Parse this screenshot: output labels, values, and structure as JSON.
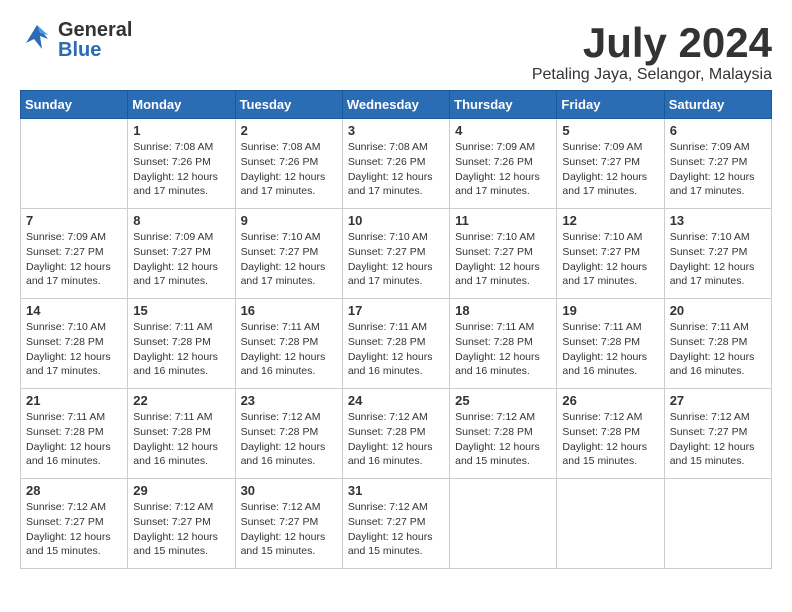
{
  "header": {
    "logo_general": "General",
    "logo_blue": "Blue",
    "month_title": "July 2024",
    "location": "Petaling Jaya, Selangor, Malaysia"
  },
  "days_of_week": [
    "Sunday",
    "Monday",
    "Tuesday",
    "Wednesday",
    "Thursday",
    "Friday",
    "Saturday"
  ],
  "weeks": [
    [
      {
        "num": "",
        "info": ""
      },
      {
        "num": "1",
        "info": "Sunrise: 7:08 AM\nSunset: 7:26 PM\nDaylight: 12 hours\nand 17 minutes."
      },
      {
        "num": "2",
        "info": "Sunrise: 7:08 AM\nSunset: 7:26 PM\nDaylight: 12 hours\nand 17 minutes."
      },
      {
        "num": "3",
        "info": "Sunrise: 7:08 AM\nSunset: 7:26 PM\nDaylight: 12 hours\nand 17 minutes."
      },
      {
        "num": "4",
        "info": "Sunrise: 7:09 AM\nSunset: 7:26 PM\nDaylight: 12 hours\nand 17 minutes."
      },
      {
        "num": "5",
        "info": "Sunrise: 7:09 AM\nSunset: 7:27 PM\nDaylight: 12 hours\nand 17 minutes."
      },
      {
        "num": "6",
        "info": "Sunrise: 7:09 AM\nSunset: 7:27 PM\nDaylight: 12 hours\nand 17 minutes."
      }
    ],
    [
      {
        "num": "7",
        "info": "Sunrise: 7:09 AM\nSunset: 7:27 PM\nDaylight: 12 hours\nand 17 minutes."
      },
      {
        "num": "8",
        "info": "Sunrise: 7:09 AM\nSunset: 7:27 PM\nDaylight: 12 hours\nand 17 minutes."
      },
      {
        "num": "9",
        "info": "Sunrise: 7:10 AM\nSunset: 7:27 PM\nDaylight: 12 hours\nand 17 minutes."
      },
      {
        "num": "10",
        "info": "Sunrise: 7:10 AM\nSunset: 7:27 PM\nDaylight: 12 hours\nand 17 minutes."
      },
      {
        "num": "11",
        "info": "Sunrise: 7:10 AM\nSunset: 7:27 PM\nDaylight: 12 hours\nand 17 minutes."
      },
      {
        "num": "12",
        "info": "Sunrise: 7:10 AM\nSunset: 7:27 PM\nDaylight: 12 hours\nand 17 minutes."
      },
      {
        "num": "13",
        "info": "Sunrise: 7:10 AM\nSunset: 7:27 PM\nDaylight: 12 hours\nand 17 minutes."
      }
    ],
    [
      {
        "num": "14",
        "info": "Sunrise: 7:10 AM\nSunset: 7:28 PM\nDaylight: 12 hours\nand 17 minutes."
      },
      {
        "num": "15",
        "info": "Sunrise: 7:11 AM\nSunset: 7:28 PM\nDaylight: 12 hours\nand 16 minutes."
      },
      {
        "num": "16",
        "info": "Sunrise: 7:11 AM\nSunset: 7:28 PM\nDaylight: 12 hours\nand 16 minutes."
      },
      {
        "num": "17",
        "info": "Sunrise: 7:11 AM\nSunset: 7:28 PM\nDaylight: 12 hours\nand 16 minutes."
      },
      {
        "num": "18",
        "info": "Sunrise: 7:11 AM\nSunset: 7:28 PM\nDaylight: 12 hours\nand 16 minutes."
      },
      {
        "num": "19",
        "info": "Sunrise: 7:11 AM\nSunset: 7:28 PM\nDaylight: 12 hours\nand 16 minutes."
      },
      {
        "num": "20",
        "info": "Sunrise: 7:11 AM\nSunset: 7:28 PM\nDaylight: 12 hours\nand 16 minutes."
      }
    ],
    [
      {
        "num": "21",
        "info": "Sunrise: 7:11 AM\nSunset: 7:28 PM\nDaylight: 12 hours\nand 16 minutes."
      },
      {
        "num": "22",
        "info": "Sunrise: 7:11 AM\nSunset: 7:28 PM\nDaylight: 12 hours\nand 16 minutes."
      },
      {
        "num": "23",
        "info": "Sunrise: 7:12 AM\nSunset: 7:28 PM\nDaylight: 12 hours\nand 16 minutes."
      },
      {
        "num": "24",
        "info": "Sunrise: 7:12 AM\nSunset: 7:28 PM\nDaylight: 12 hours\nand 16 minutes."
      },
      {
        "num": "25",
        "info": "Sunrise: 7:12 AM\nSunset: 7:28 PM\nDaylight: 12 hours\nand 15 minutes."
      },
      {
        "num": "26",
        "info": "Sunrise: 7:12 AM\nSunset: 7:28 PM\nDaylight: 12 hours\nand 15 minutes."
      },
      {
        "num": "27",
        "info": "Sunrise: 7:12 AM\nSunset: 7:27 PM\nDaylight: 12 hours\nand 15 minutes."
      }
    ],
    [
      {
        "num": "28",
        "info": "Sunrise: 7:12 AM\nSunset: 7:27 PM\nDaylight: 12 hours\nand 15 minutes."
      },
      {
        "num": "29",
        "info": "Sunrise: 7:12 AM\nSunset: 7:27 PM\nDaylight: 12 hours\nand 15 minutes."
      },
      {
        "num": "30",
        "info": "Sunrise: 7:12 AM\nSunset: 7:27 PM\nDaylight: 12 hours\nand 15 minutes."
      },
      {
        "num": "31",
        "info": "Sunrise: 7:12 AM\nSunset: 7:27 PM\nDaylight: 12 hours\nand 15 minutes."
      },
      {
        "num": "",
        "info": ""
      },
      {
        "num": "",
        "info": ""
      },
      {
        "num": "",
        "info": ""
      }
    ]
  ]
}
